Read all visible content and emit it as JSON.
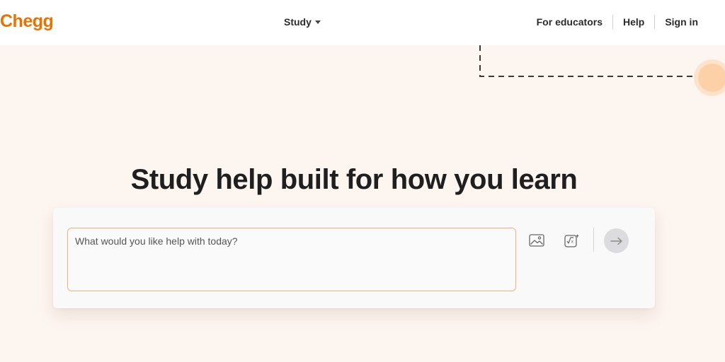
{
  "header": {
    "logo_text": "Chegg",
    "nav": {
      "study_label": "Study",
      "for_educators_label": "For educators",
      "help_label": "Help",
      "sign_in_label": "Sign in"
    }
  },
  "hero": {
    "title": "Study help built for how you learn"
  },
  "search": {
    "placeholder": "What would you like help with today?",
    "value": "",
    "image_button_icon": "image-icon",
    "math_button_icon": "math-formula-icon",
    "submit_button_icon": "arrow-right-icon"
  },
  "colors": {
    "brand": "#eb7100",
    "background": "#fdf5f0",
    "input_border": "#f0b27a",
    "accent_circle": "#fcd1a8"
  }
}
